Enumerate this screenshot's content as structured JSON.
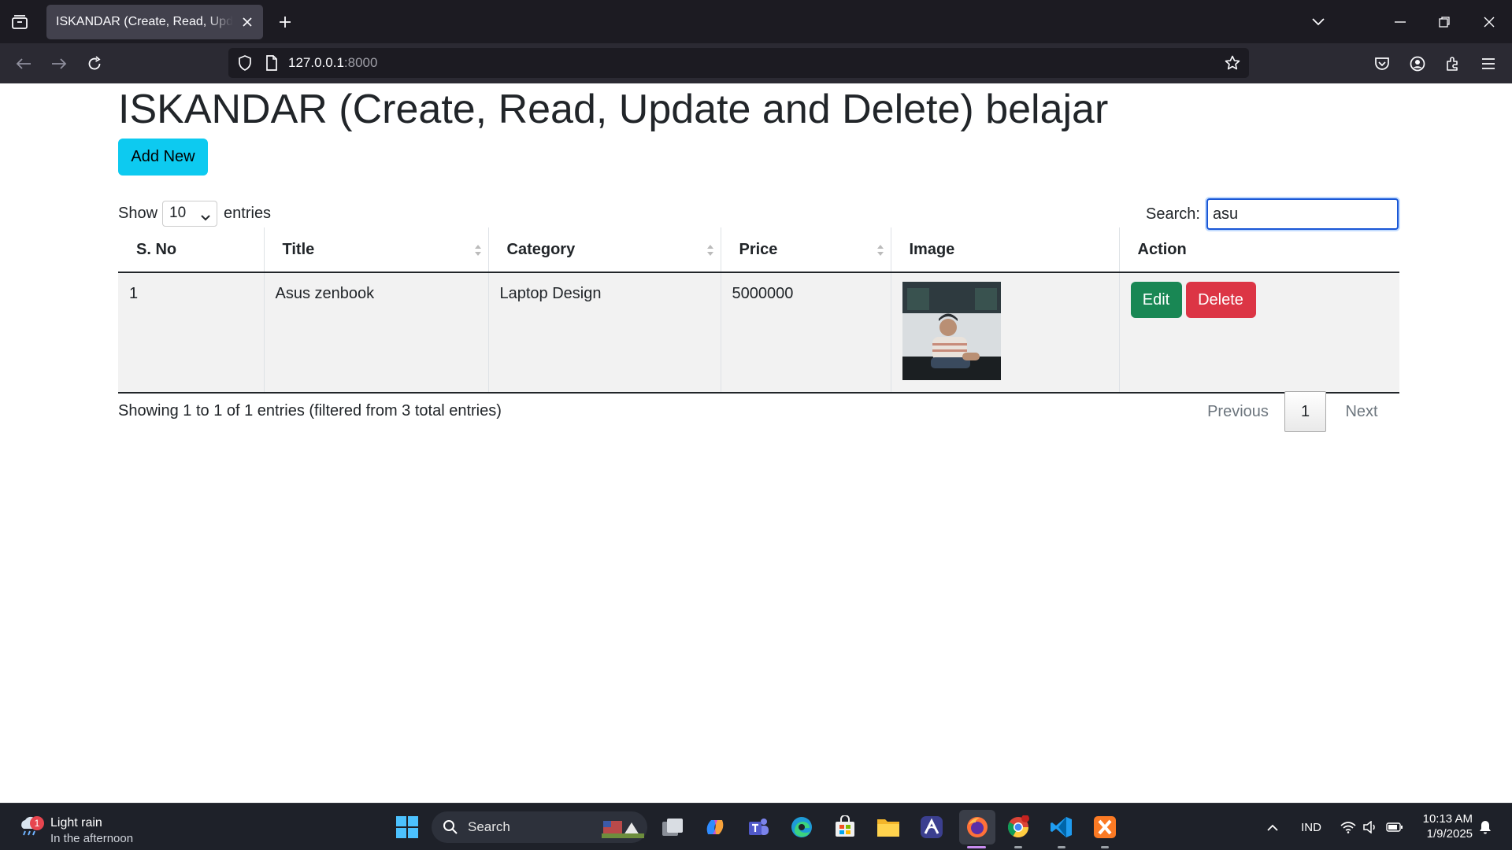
{
  "browser": {
    "tab_title": "ISKANDAR (Create, Read, Update and Delete) belajar",
    "url_host": "127.0.0.1",
    "url_port": ":8000"
  },
  "page": {
    "title": "ISKANDAR (Create, Read, Update and Delete) belajar",
    "add_button": "Add New",
    "show_label": "Show",
    "entries_label": "entries",
    "page_length": "10",
    "search_label": "Search:",
    "search_value": "asu",
    "columns": [
      "S. No",
      "Title",
      "Category",
      "Price",
      "Image",
      "Action"
    ],
    "rows": [
      {
        "sno": "1",
        "title": "Asus zenbook",
        "category": "Laptop Design",
        "price": "5000000",
        "edit": "Edit",
        "delete": "Delete"
      }
    ],
    "info": "Showing 1 to 1 of 1 entries (filtered from 3 total entries)",
    "pagination": {
      "previous": "Previous",
      "current": "1",
      "next": "Next"
    }
  },
  "taskbar": {
    "weather_title": "Light rain",
    "weather_sub": "In the afternoon",
    "weather_badge": "1",
    "search_label": "Search",
    "language": "IND",
    "time": "10:13 AM",
    "date": "1/9/2025"
  },
  "colors": {
    "add_button": "#0dcaf0",
    "edit_button": "#198754",
    "delete_button": "#dc3545",
    "browser_tabbar": "#1c1b22",
    "browser_nav": "#2b2a33",
    "taskbar": "#1e2129"
  }
}
